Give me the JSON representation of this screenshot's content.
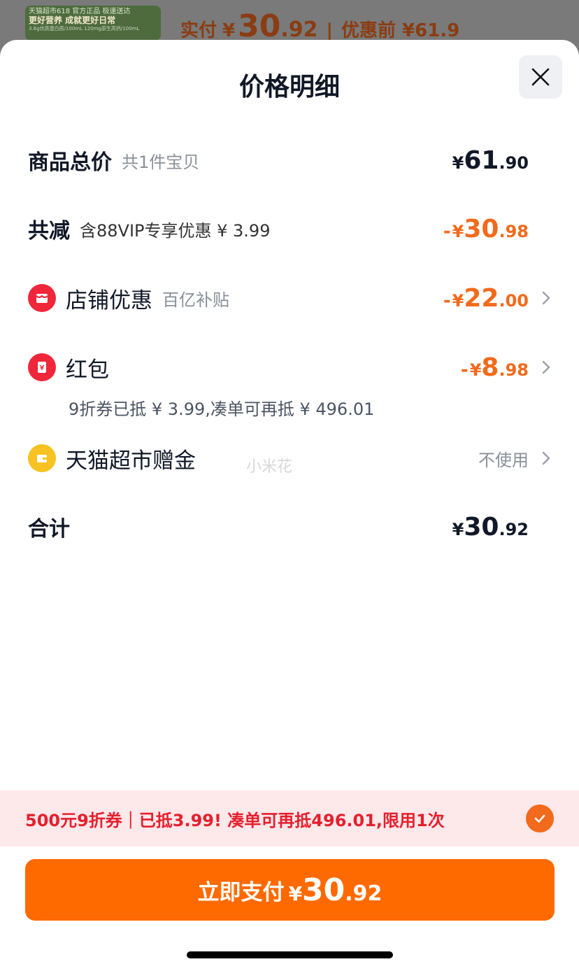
{
  "background": {
    "banner_line1": "天猫超市618 官方正品 极速送达",
    "banner_line2": "更好营养 成就更好日常",
    "banner_line3": "3.6g优质蛋白质/100mL 120mg原生高钙/100mL",
    "paid_label": "实付",
    "paid_currency": "¥",
    "paid_int": "30",
    "paid_dec": ".92",
    "separator": "|",
    "original_label": "优惠前 ¥61.9"
  },
  "sheet": {
    "title": "价格明细",
    "close_icon": "close-icon"
  },
  "total_goods": {
    "label": "商品总价",
    "sub": "共1件宝贝",
    "currency": "¥",
    "int": "61",
    "dec": ".90"
  },
  "total_discount": {
    "label": "共减",
    "sub": "含88VIP专享优惠 ¥ 3.99",
    "minus": "-",
    "currency": "¥",
    "int": "30",
    "dec": ".98"
  },
  "store_discount": {
    "icon": "store-icon",
    "label": "店铺优惠",
    "sub": "百亿补贴",
    "minus": "-",
    "currency": "¥",
    "int": "22",
    "dec": ".00"
  },
  "red_packet": {
    "icon": "red-packet-icon",
    "label": "红包",
    "minus": "-",
    "currency": "¥",
    "int": "8",
    "dec": ".98",
    "note": "9折券已抵 ¥ 3.99,凑单可再抵 ¥ 496.01"
  },
  "gift_money": {
    "icon": "wallet-icon",
    "label": "天猫超市赠金",
    "value": "不使用"
  },
  "watermark": "小米花",
  "sum": {
    "label": "合计",
    "currency": "¥",
    "int": "30",
    "dec": ".92"
  },
  "promo": {
    "text": "500元9折券｜已抵3.99! 凑单可再抵496.01,限用1次",
    "checked": true
  },
  "pay_button": {
    "label": "立即支付",
    "currency": "¥",
    "int": "30",
    "dec": ".92"
  },
  "colors": {
    "accent": "#ff6a00",
    "discount": "#f26a1b",
    "promo_text": "#e5202e",
    "promo_bg": "#fde8ea"
  }
}
